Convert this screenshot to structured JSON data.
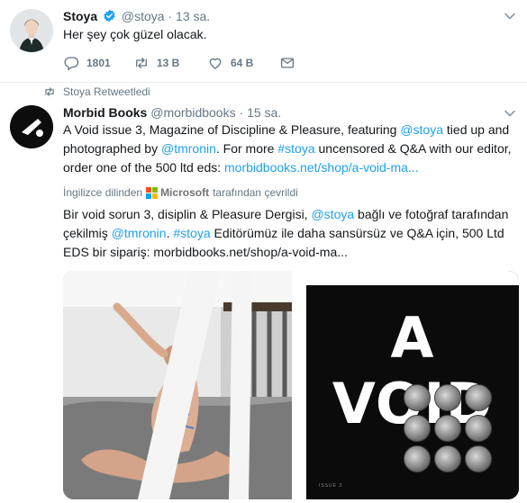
{
  "tweet1": {
    "name": "Stoya",
    "handle": "@stoya",
    "separator": "·",
    "time": "13 sa.",
    "text": "Her şey çok güzel olacak.",
    "actions": {
      "reply_count": "1801",
      "retweet_count": "13 B",
      "like_count": "64 B"
    }
  },
  "retweet_context": {
    "label": "Stoya Retweetledi"
  },
  "tweet2": {
    "name": "Morbid Books",
    "handle": "@morbidbooks",
    "separator": "·",
    "time": "15 sa.",
    "text_parts": {
      "p1": "A Void issue 3, Magazine of Discipline & Pleasure, featuring ",
      "mention1": "@stoya",
      "p2": " tied up and photographed by ",
      "mention2": "@tmronin",
      "p3": ". For more ",
      "hashtag": "#stoya",
      "p4": " uncensored & Q&A with our editor, order one of the 500 ltd eds: ",
      "url": "morbidbooks.net/shop/a-void-ma..."
    },
    "translation_notice": {
      "prefix": "İngilizce dilinden",
      "provider": "Microsoft",
      "suffix": "tarafından çevrildi"
    },
    "translated_parts": {
      "p1": "Bir void sorun 3, disiplin & Pleasure Dergisi, ",
      "mention1": "@stoya",
      "p2": " bağlı ve fotoğraf tarafından çekilmiş ",
      "mention2": "@tmronin",
      "p3": ". ",
      "hashtag": "#stoya",
      "p4": " Editörümüz ile daha sansürsüz ve Q&A için, 500 Ltd EDS bir sipariş: morbidbooks.net/shop/a-void-ma..."
    },
    "media": {
      "cover_title": "A VOID",
      "cover_issue": "ISSUE 3"
    }
  },
  "colors": {
    "link": "#1da1f2",
    "muted": "#657786",
    "verified": "#1da1f2"
  },
  "icons": [
    "verified-badge-icon",
    "chevron-down-icon",
    "reply-icon",
    "retweet-icon",
    "like-icon",
    "message-icon",
    "retweeted-icon",
    "microsoft-logo-icon"
  ]
}
